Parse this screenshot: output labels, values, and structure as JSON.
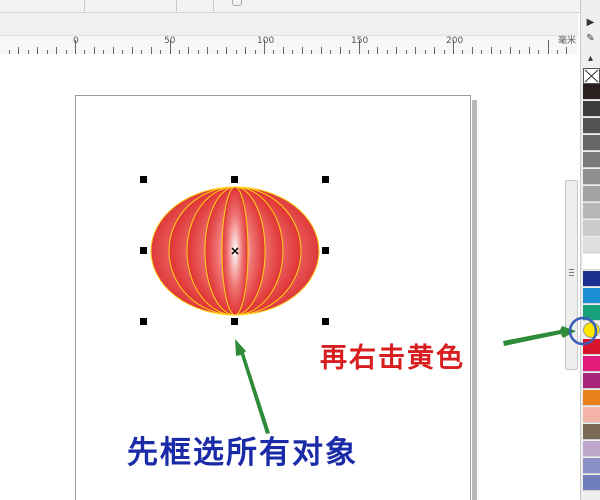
{
  "ruler": {
    "labels": [
      "0",
      "50",
      "100",
      "150",
      "200"
    ],
    "unit": "毫米"
  },
  "annotations": {
    "right_click_yellow": "再右击黄色",
    "select_all_objects": "先框选所有对象"
  },
  "palette": {
    "colors": [
      "#2b1f1f",
      "#3d3d3d",
      "#525252",
      "#666666",
      "#7a7a7a",
      "#8f8f8f",
      "#a3a3a3",
      "#b8b8b8",
      "#cccccc",
      "#e0e0e0",
      "#ffffff",
      "#1b2f8f",
      "#1a8fd6",
      "#18a07a",
      "#ffe600",
      "#d8132c",
      "#e01b7a",
      "#a8257a",
      "#e8801a",
      "#f3b3a6",
      "#7a6a55",
      "#c0a8cc",
      "#8a8fc8",
      "#6f7fbd"
    ],
    "highlighted": "#ffe600"
  },
  "colors": {
    "annotation_red": "#d81e1e",
    "annotation_blue": "#1b2aa6",
    "arrow_green": "#2e8b3a",
    "highlight_circle": "#3a5fb8",
    "lantern_edge": "#d81e1e",
    "lantern_outline": "#ffd21a"
  }
}
